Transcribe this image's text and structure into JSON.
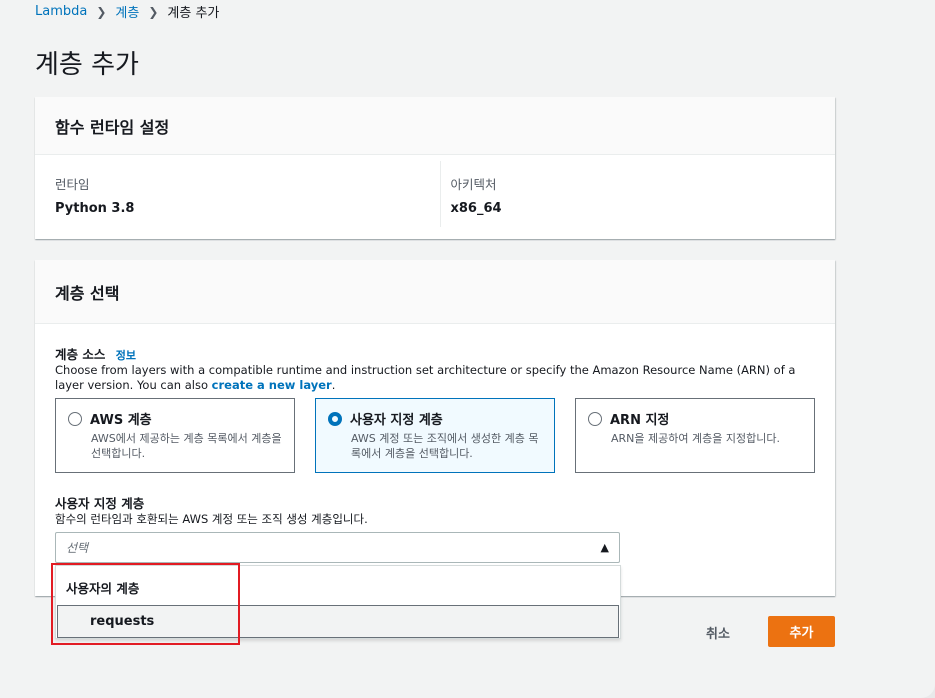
{
  "breadcrumb": {
    "items": [
      "Lambda",
      "계층"
    ],
    "current": "계층 추가"
  },
  "page": {
    "title": "계층 추가"
  },
  "runtime_settings": {
    "header": "함수 런타임 설정",
    "runtime_label": "런타임",
    "runtime_value": "Python 3.8",
    "arch_label": "아키텍처",
    "arch_value": "x86_64"
  },
  "layer_select": {
    "header": "계층 선택",
    "source_label": "계층 소스",
    "info_link": "정보",
    "description_prefix": "Choose from layers with a compatible runtime and instruction set architecture or specify the Amazon Resource Name (ARN) of a layer version. You can also ",
    "description_link": "create a new layer",
    "description_suffix": ".",
    "tiles": [
      {
        "title": "AWS 계층",
        "description": "AWS에서 제공하는 계층 목록에서 계층을 선택합니다.",
        "selected": false
      },
      {
        "title": "사용자 지정 계층",
        "description": "AWS 계정 또는 조직에서 생성한 계층 목록에서 계층을 선택합니다.",
        "selected": true
      },
      {
        "title": "ARN 지정",
        "description": "ARN을 제공하여 계층을 지정합니다.",
        "selected": false
      }
    ],
    "custom_label": "사용자 지정 계층",
    "custom_desc": "함수의 런타임과 호환되는 AWS 계정 또는 조직 생성 계층입니다.",
    "select_placeholder": "선택"
  },
  "dropdown": {
    "group_label": "사용자의 계층",
    "options": [
      "requests"
    ]
  },
  "actions": {
    "cancel_label": "취소",
    "add_label": "추가"
  },
  "colors": {
    "primary_button": "#ec7211",
    "link": "#0073bb",
    "highlight_box": "#e21b23"
  }
}
